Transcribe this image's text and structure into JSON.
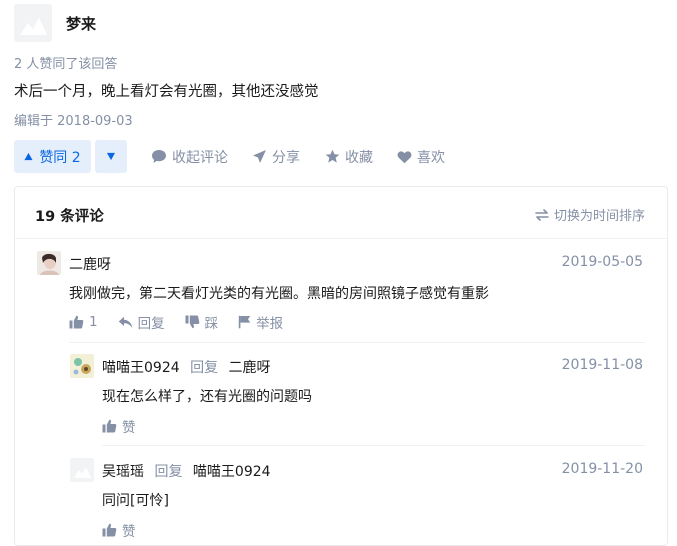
{
  "answer": {
    "author": "梦来",
    "likers_text": "2 人赞同了该回答",
    "content": "术后一个月，晚上看灯会有光圈，其他还没感觉",
    "edited": "编辑于 2018-09-03"
  },
  "actions": {
    "vote_up": "赞同 2",
    "comment": "收起评论",
    "share": "分享",
    "collect": "收藏",
    "like": "喜欢"
  },
  "comments": {
    "count": "19 条评论",
    "switch_order": "切换为时间排序",
    "items": [
      {
        "author": "二鹿呀",
        "date": "2019-05-05",
        "text": "我刚做完，第二天看灯光类的有光圈。黑暗的房间照镜子感觉有重影",
        "likes": "1",
        "reply": "回复",
        "dislike": "踩",
        "report": "举报"
      },
      {
        "author": "喵喵王0924",
        "reply_word": "回复",
        "reply_to": "二鹿呀",
        "date": "2019-11-08",
        "text": "现在怎么样了，还有光圈的问题吗",
        "like": "赞"
      },
      {
        "author": "吴瑶瑶",
        "reply_word": "回复",
        "reply_to": "喵喵王0924",
        "date": "2019-11-20",
        "text": "同问[可怜]",
        "like": "赞"
      }
    ]
  },
  "colors": {
    "accent": "#0a66e1",
    "accent_bg": "#e5effb",
    "meta": "#8590a6",
    "icon": "#8590a6"
  }
}
